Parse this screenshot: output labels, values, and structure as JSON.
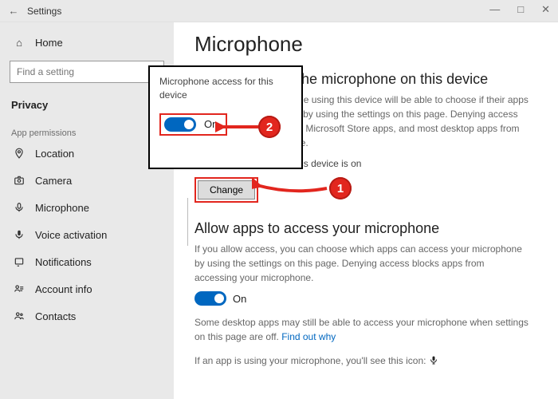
{
  "titlebar": {
    "back_glyph": "←",
    "title": "Settings"
  },
  "window_controls": {
    "min": "—",
    "max": "□",
    "close": "✕"
  },
  "sidebar": {
    "home": {
      "icon": "⌂",
      "label": "Home"
    },
    "search_placeholder": "Find a setting",
    "group": "Privacy",
    "section": "App permissions",
    "items": [
      {
        "icon_name": "location-icon",
        "label": "Location"
      },
      {
        "icon_name": "camera-icon",
        "label": "Camera"
      },
      {
        "icon_name": "microphone-icon",
        "label": "Microphone"
      },
      {
        "icon_name": "voice-icon",
        "label": "Voice activation"
      },
      {
        "icon_name": "notifications-icon",
        "label": "Notifications"
      },
      {
        "icon_name": "account-icon",
        "label": "Account info"
      },
      {
        "icon_name": "contacts-icon",
        "label": "Contacts"
      }
    ]
  },
  "content": {
    "heading": "Microphone",
    "section1_title": "Allow access to the microphone on this device",
    "section1_desc": "If you allow access, people using this device will be able to choose if their apps have microphone access by using the settings on this page. Denying access blocks Windows features, Microsoft Store apps, and most desktop apps from accessing the microphone.",
    "device_status": "Microphone access for this device is on",
    "change_label": "Change",
    "section2_title": "Allow apps to access your microphone",
    "section2_desc": "If you allow access, you can choose which apps can access your microphone by using the settings on this page. Denying access blocks apps from accessing your microphone.",
    "toggle2_label": "On",
    "note1": "Some desktop apps may still be able to access your microphone when settings on this page are off. ",
    "note1_link": "Find out why",
    "note2_prefix": "If an app is using your microphone, you'll see this icon: "
  },
  "popup": {
    "title": "Microphone access for this device",
    "toggle_label": "On"
  },
  "annotations": {
    "badge1": "1",
    "badge2": "2"
  }
}
